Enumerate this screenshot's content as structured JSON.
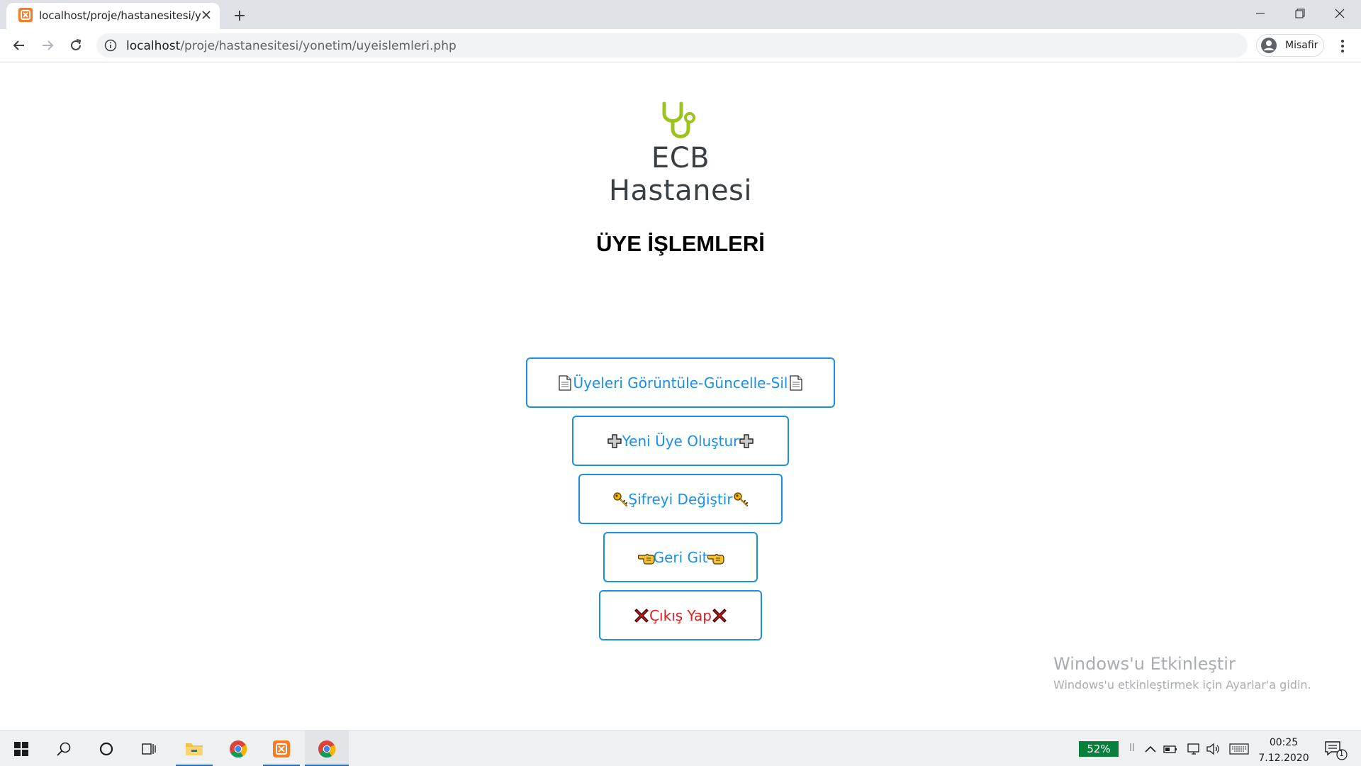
{
  "browser": {
    "tab_title": "localhost/proje/hastanesitesi/yon",
    "url_host": "localhost",
    "url_path": "/proje/hastanesitesi/yonetim/uyeislemleri.php",
    "profile_label": "Misafir"
  },
  "page": {
    "logo_text": "ECB Hastanesi",
    "title": "ÜYE İŞLEMLERİ",
    "buttons": [
      {
        "label": "Üyeleri Görüntüle-Güncelle-Sil",
        "icon": "page-icon",
        "color": "#1a8fe8"
      },
      {
        "label": "Yeni Üye Oluştur",
        "icon": "plus-icon",
        "color": "#1a8fe8"
      },
      {
        "label": "Şifreyi Değiştir",
        "icon": "key-icon",
        "color": "#1a8fe8"
      },
      {
        "label": "Geri Git",
        "icon": "pointing-hand-icon",
        "color": "#1a8fe8"
      },
      {
        "label": "Çıkış Yap",
        "icon": "cross-mark-icon",
        "color": "#e02020"
      }
    ],
    "accent_color": "#1a8fe8",
    "logo_color": "#9cc320"
  },
  "watermark": {
    "title": "Windows'u Etkinleştir",
    "subtitle": "Windows'u etkinleştirmek için Ayarlar'a gidin."
  },
  "taskbar": {
    "battery": "52%",
    "time": "00:25",
    "date": "7.12.2020",
    "notification_count": "1"
  }
}
